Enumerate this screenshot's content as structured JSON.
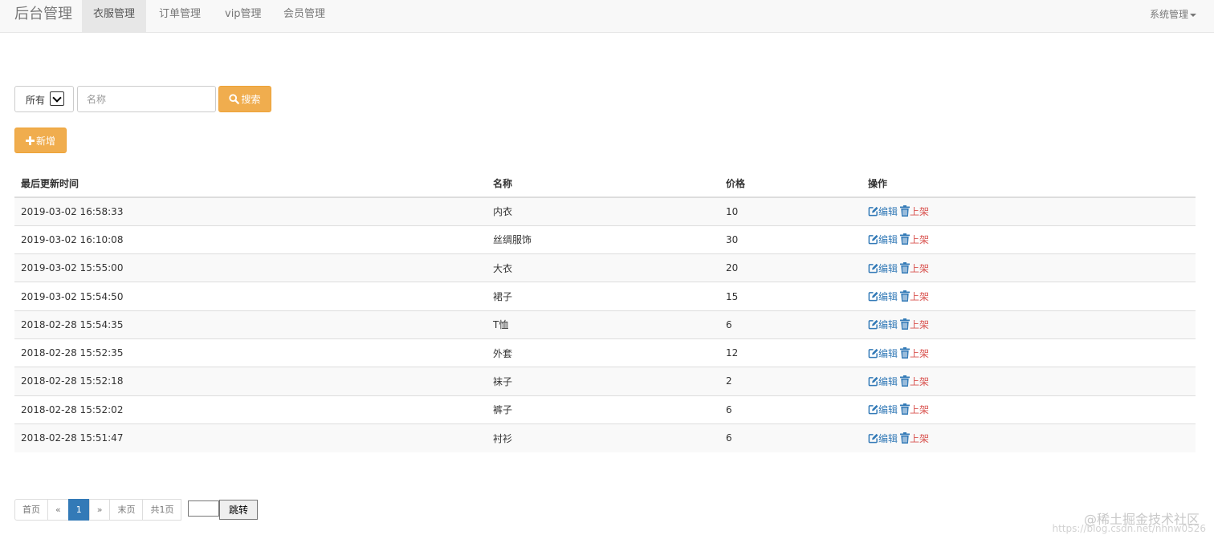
{
  "navbar": {
    "brand": "后台管理",
    "tabs": [
      {
        "label": "衣服管理",
        "active": true
      },
      {
        "label": "订单管理",
        "active": false
      },
      {
        "label": "vip管理",
        "active": false
      },
      {
        "label": "会员管理",
        "active": false
      }
    ],
    "system_menu": "系统管理"
  },
  "search": {
    "filter_selected": "所有",
    "name_placeholder": "名称",
    "search_label": "搜索"
  },
  "toolbar": {
    "add_label": "新增"
  },
  "table": {
    "headers": [
      "最后更新时间",
      "名称",
      "价格",
      "操作"
    ],
    "edit_label": "编辑",
    "shelf_label": "上架",
    "rows": [
      {
        "updated": "2019-03-02 16:58:33",
        "name": "内衣",
        "price": "10"
      },
      {
        "updated": "2019-03-02 16:10:08",
        "name": "丝绸服饰",
        "price": "30"
      },
      {
        "updated": "2019-03-02 15:55:00",
        "name": "大衣",
        "price": "20"
      },
      {
        "updated": "2019-03-02 15:54:50",
        "name": "裙子",
        "price": "15"
      },
      {
        "updated": "2018-02-28 15:54:35",
        "name": "T恤",
        "price": "6"
      },
      {
        "updated": "2018-02-28 15:52:35",
        "name": "外套",
        "price": "12"
      },
      {
        "updated": "2018-02-28 15:52:18",
        "name": "袜子",
        "price": "2"
      },
      {
        "updated": "2018-02-28 15:52:02",
        "name": "裤子",
        "price": "6"
      },
      {
        "updated": "2018-02-28 15:51:47",
        "name": "衬衫",
        "price": "6"
      }
    ]
  },
  "pagination": {
    "first": "首页",
    "prev": "«",
    "current": "1",
    "next": "»",
    "last": "末页",
    "total": "共1页",
    "jump_label": "跳转"
  },
  "watermark": {
    "text": "@稀土掘金技术社区",
    "url": "https://blog.csdn.net/nhnw0526"
  },
  "colors": {
    "warning": "#f0ad4e",
    "primary": "#337ab7",
    "danger": "#d9534f"
  }
}
